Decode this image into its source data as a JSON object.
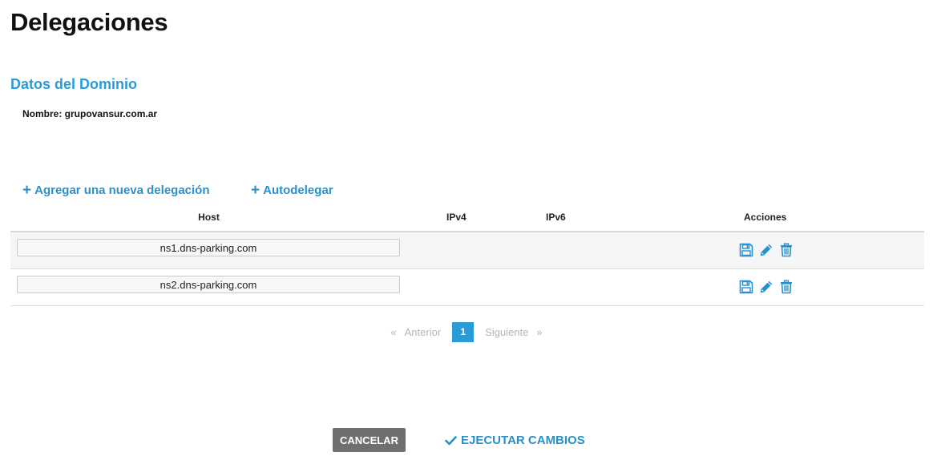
{
  "page": {
    "title": "Delegaciones"
  },
  "domain": {
    "section_title": "Datos del Dominio",
    "name_label": "Nombre: grupovansur.com.ar"
  },
  "actions": {
    "add_label": "Agregar una nueva delegación",
    "auto_label": "Autodelegar",
    "plus_glyph": "+"
  },
  "table": {
    "headers": {
      "host": "Host",
      "ipv4": "IPv4",
      "ipv6": "IPv6",
      "actions": "Acciones"
    },
    "rows": [
      {
        "host": "ns1.dns-parking.com",
        "ipv4": "",
        "ipv6": ""
      },
      {
        "host": "ns2.dns-parking.com",
        "ipv4": "",
        "ipv6": ""
      }
    ],
    "row_icons": [
      "save-icon",
      "edit-icon",
      "trash-icon"
    ]
  },
  "pagination": {
    "prev_arrow": "«",
    "prev_label": "Anterior",
    "current_page": "1",
    "next_label": "Siguiente",
    "next_arrow": "»"
  },
  "footer": {
    "cancel_label": "CANCELAR",
    "execute_label": "EJECUTAR CAMBIOS"
  },
  "colors": {
    "accent": "#2a9bd6",
    "link": "#2a8fcb",
    "cancel_bg": "#6f6f6f",
    "muted": "#b5b5b5"
  }
}
